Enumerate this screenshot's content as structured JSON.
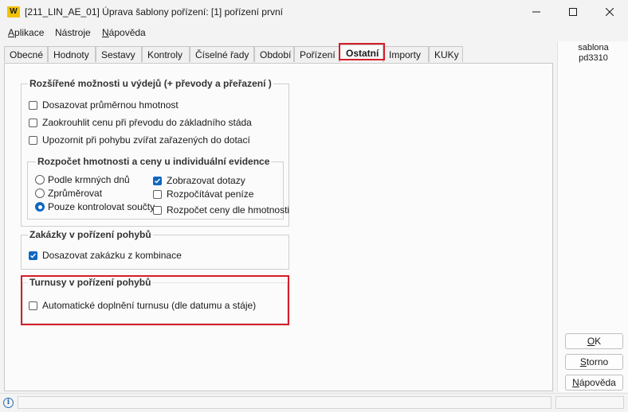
{
  "window": {
    "logo_text": "W",
    "title": "[211_LIN_AE_01] Úprava šablony pořízení: [1] pořízení první"
  },
  "menu": {
    "items": [
      {
        "label_u": "A",
        "label_rest": "plikace"
      },
      {
        "label_pre": "Nástro",
        "label_u": "j",
        "label_rest": "e"
      },
      {
        "label_u": "N",
        "label_rest": "ápověda"
      }
    ]
  },
  "tabs": [
    {
      "label": "Obecné"
    },
    {
      "label": "Hodnoty"
    },
    {
      "label": "Sestavy"
    },
    {
      "label": "Kontroly"
    },
    {
      "label": "Číselné řady"
    },
    {
      "label": "Období"
    },
    {
      "label": "Pořízení"
    },
    {
      "label": "Ostatní",
      "active": true
    },
    {
      "label": "Importy"
    },
    {
      "label": "KUKy"
    }
  ],
  "side": {
    "line1": "sablona",
    "line2": "pd3310"
  },
  "groups": {
    "vydej": {
      "title": "Rozšířené možnosti u výdejů (+ převody a přeřazení )",
      "options": [
        {
          "label": "Dosazovat průměrnou hmotnost",
          "checked": false
        },
        {
          "label": "Zaokrouhlit cenu při převodu do základního stáda",
          "checked": false
        },
        {
          "label": "Upozornit při pohybu zvířat zařazených do dotací",
          "checked": false
        }
      ]
    },
    "rozpocet": {
      "title": "Rozpočet hmotnosti a ceny u individuální evidence",
      "radios": [
        {
          "label": "Podle krmných dnů",
          "checked": false
        },
        {
          "label": "Zprůměrovat",
          "checked": false
        },
        {
          "label": "Pouze kontrolovat součty",
          "checked": true
        }
      ],
      "checks": [
        {
          "label": "Zobrazovat dotazy",
          "checked": true
        },
        {
          "label": "Rozpočítávat peníze",
          "checked": false
        },
        {
          "label": "Rozpočet ceny dle hmotnosti",
          "checked": false
        }
      ]
    },
    "zakazky": {
      "title": "Zakázky v pořízení pohybů",
      "options": [
        {
          "label": "Dosazovat zakázku z kombinace",
          "checked": true
        }
      ]
    },
    "turnusy": {
      "title": "Turnusy v pořízení pohybů",
      "options": [
        {
          "label": "Automatické doplnění turnusu (dle datumu a stáje)",
          "checked": false
        }
      ]
    }
  },
  "buttons": {
    "ok": {
      "u": "O",
      "rest": "K"
    },
    "storno": {
      "u": "S",
      "rest": "torno"
    },
    "napoveda": {
      "u": "N",
      "rest": "ápověda"
    }
  },
  "colors": {
    "accent": "#0f67c0",
    "highlight": "#d41e2a",
    "logo": "#f2c200"
  }
}
